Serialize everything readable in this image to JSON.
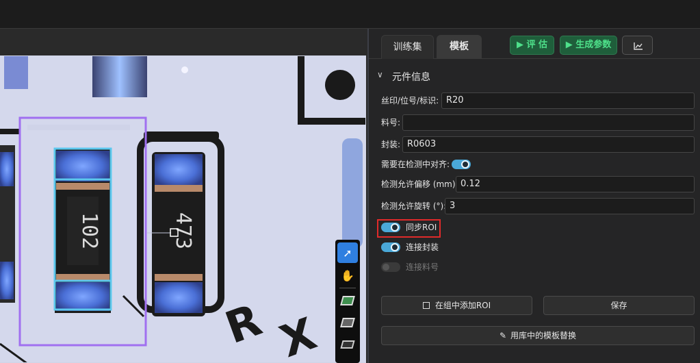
{
  "tabs": [
    {
      "label": "训练集"
    },
    {
      "label": "模板"
    }
  ],
  "toolbar": {
    "eval_label": "▶ 评 估",
    "gen_label": "▶ 生成参数",
    "chart_icon": "line-chart-icon"
  },
  "section": {
    "title": "元件信息"
  },
  "form": {
    "silk_label": "丝印/位号/标识:",
    "silk_value": "R20",
    "part_label": "料号:",
    "part_value": "",
    "package_label": "封装:",
    "package_value": "R0603",
    "align_label": "需要在检测中对齐:",
    "offset_label": "检测允许偏移 (mm):",
    "offset_value": "0.12",
    "rotate_label": "检测允许旋转 (°):",
    "rotate_value": "3",
    "sync_roi_label": "同步ROI",
    "link_package_label": "连接封装",
    "link_part_label": "连接料号"
  },
  "toggles": {
    "align": true,
    "sync_roi": true,
    "link_package": true,
    "link_part": false
  },
  "buttons": {
    "add_roi_label": "在组中添加ROI",
    "save_label": "保存",
    "replace_label": "用库中的模板替换"
  },
  "canvas": {
    "component_left_text": "102",
    "component_right_text": "473"
  },
  "colors": {
    "accent_green": "#4ee08a",
    "toggle_on": "#4aa8d8",
    "highlight_red": "#e02a2a",
    "roi_purple": "#a070f0",
    "roi_cyan": "#5cc8ee"
  }
}
